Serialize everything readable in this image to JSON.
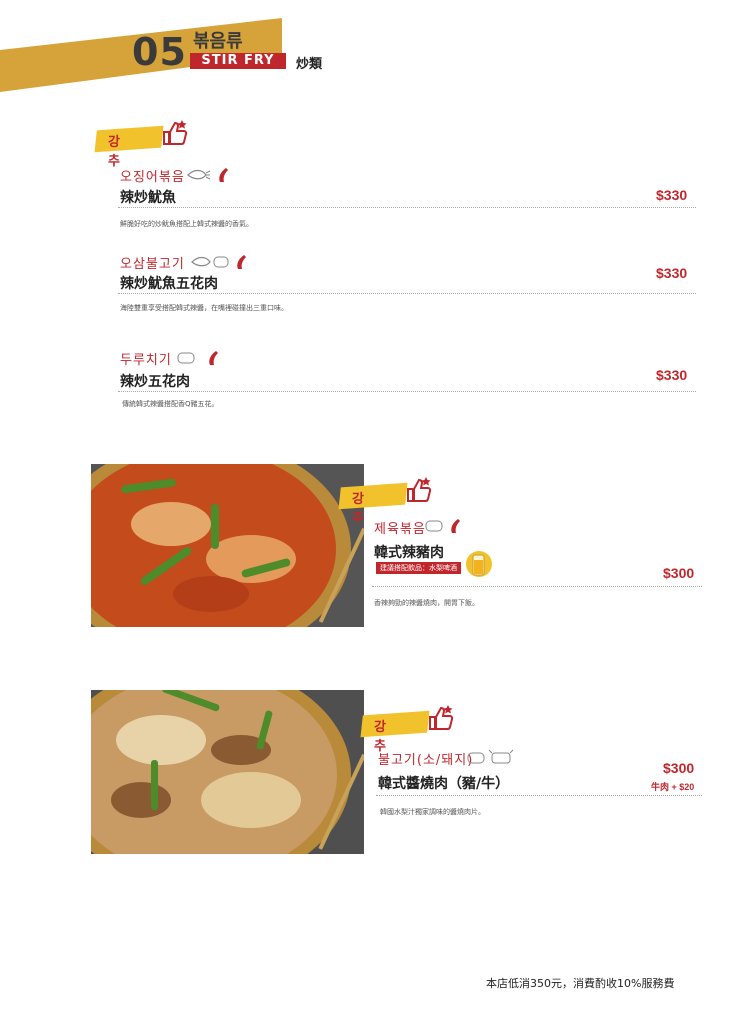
{
  "section": {
    "number": "05",
    "title_ko": "볶음류",
    "title_en": "STIR FRY",
    "title_zh": "炒類",
    "banner_color": "#d6a33a"
  },
  "tags": {
    "recommend": "강 추"
  },
  "items": [
    {
      "ko": "오징어볶음",
      "name": "辣炒魷魚",
      "price": "$330",
      "desc": "鮮脆好吃的炒魷魚搭配上韓式辣醬的香氣。"
    },
    {
      "ko": "오삼불고기",
      "name": "辣炒魷魚五花肉",
      "price": "$330",
      "desc": "海陸雙重享受搭配韓式辣醬，在嘴裡碰撞出三重口味。"
    },
    {
      "ko": "두루치기",
      "name": "辣炒五花肉",
      "price": "$330",
      "desc": "傳統韓式辣醬搭配香Q豬五花。"
    },
    {
      "ko": "제육볶음",
      "name": "韓式辣豬肉",
      "price": "$300",
      "desc": "香辣夠勁的辣醬燒肉，開胃下飯。",
      "badge": "建議搭配飲品：水梨啤酒"
    },
    {
      "ko": "불고기(소/돼지)",
      "name": "韓式醬燒肉（豬/牛）",
      "price": "$300",
      "extra": "牛肉 + $20",
      "desc": "韓國水梨汁獨家調味的醬燒肉片。"
    }
  ],
  "footer": "本店低消350元，消費酌收10%服務費",
  "colors": {
    "accent": "#c0272d",
    "tag_yellow": "#f1c22c"
  }
}
